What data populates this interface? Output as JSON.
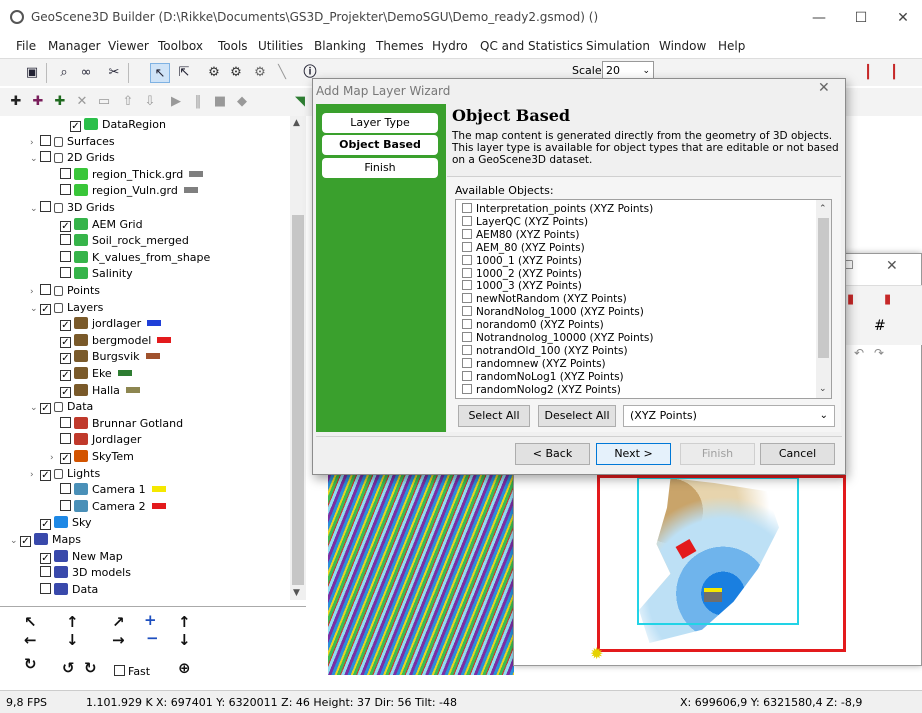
{
  "window": {
    "title": "GeoScene3D Builder (D:\\Rikke\\Documents\\GS3D_Projekter\\DemoSGU\\Demo_ready2.gsmod) ()",
    "controls": [
      "—",
      "☐",
      "✕"
    ]
  },
  "menu": [
    "File",
    "Manager",
    "Viewer",
    "Toolbox",
    "Tools",
    "Utilities",
    "Blanking",
    "Themes",
    "Hydro",
    "QC and Statistics",
    "Simulation",
    "Window",
    "Help"
  ],
  "toolbar": {
    "scale_label": "Scale:",
    "scale_value": "20"
  },
  "tree": [
    {
      "label": "DataRegion",
      "checked": true,
      "icon": "region-icon",
      "icon_color": "#2bbf4a"
    },
    {
      "label": "Surfaces",
      "checked": false,
      "icon": "folder-icon"
    },
    {
      "label": "2D Grids",
      "checked": false,
      "icon": "folder-icon"
    },
    {
      "label": "region_Thick.grd",
      "checked": false,
      "icon": "grid2d-icon",
      "icon_color": "#39c639",
      "swatch": "#7f7f7f"
    },
    {
      "label": "region_Vuln.grd",
      "checked": false,
      "icon": "grid2d-icon",
      "icon_color": "#39c639",
      "swatch": "#7f7f7f"
    },
    {
      "label": "3D Grids",
      "checked": false,
      "icon": "folder-icon"
    },
    {
      "label": "AEM Grid",
      "checked": true,
      "icon": "grid3d-icon",
      "icon_color": "#36b44a"
    },
    {
      "label": "Soil_rock_merged",
      "checked": false,
      "icon": "grid3d-icon",
      "icon_color": "#36b44a"
    },
    {
      "label": "K_values_from_shape",
      "checked": false,
      "icon": "grid3d-icon",
      "icon_color": "#36b44a"
    },
    {
      "label": "Salinity",
      "checked": false,
      "icon": "grid3d-icon",
      "icon_color": "#36b44a"
    },
    {
      "label": "Points",
      "checked": false,
      "icon": "folder-icon"
    },
    {
      "label": "Layers",
      "checked": true,
      "icon": "folder-icon"
    },
    {
      "label": "jordlager",
      "checked": true,
      "icon": "layer-icon",
      "icon_color": "#7a5a2a",
      "swatch": "#1f3fd8"
    },
    {
      "label": "bergmodel",
      "checked": true,
      "icon": "layer-icon",
      "icon_color": "#7a5a2a",
      "swatch": "#e31a1c"
    },
    {
      "label": "Burgsvik",
      "checked": true,
      "icon": "layer-icon",
      "icon_color": "#7a5a2a",
      "swatch": "#a0522d"
    },
    {
      "label": "Eke",
      "checked": true,
      "icon": "layer-icon",
      "icon_color": "#7a5a2a",
      "swatch": "#2e7d32"
    },
    {
      "label": "Halla",
      "checked": true,
      "icon": "layer-icon",
      "icon_color": "#7a5a2a",
      "swatch": "#8d8650"
    },
    {
      "label": "Data",
      "checked": true,
      "icon": "folder-icon"
    },
    {
      "label": "Brunnar Gotland",
      "checked": false,
      "icon": "wells-icon",
      "icon_color": "#c0392b"
    },
    {
      "label": "Jordlager",
      "checked": false,
      "icon": "wells-icon",
      "icon_color": "#c0392b"
    },
    {
      "label": "SkyTem",
      "checked": true,
      "icon": "skytem-icon",
      "icon_color": "#d35400"
    },
    {
      "label": "Lights",
      "checked": true,
      "icon": "folder-icon"
    },
    {
      "label": "Camera 1",
      "checked": false,
      "icon": "camera-icon",
      "icon_color": "#4a90b8",
      "swatch": "#f5e800"
    },
    {
      "label": "Camera 2",
      "checked": false,
      "icon": "camera-icon",
      "icon_color": "#4a90b8",
      "swatch": "#e31a1c"
    },
    {
      "label": "Sky",
      "checked": true,
      "icon": "sky-icon",
      "icon_color": "#1e88e5"
    },
    {
      "label": "Maps",
      "checked": true,
      "icon": "maps-icon",
      "icon_color": "#3949ab"
    },
    {
      "label": "New Map",
      "checked": true,
      "icon": "map-icon",
      "icon_color": "#3949ab"
    },
    {
      "label": "3D models",
      "checked": false,
      "icon": "map-icon",
      "icon_color": "#3949ab"
    },
    {
      "label": "Data",
      "checked": false,
      "icon": "map-icon",
      "icon_color": "#3949ab"
    }
  ],
  "navpad": {
    "fast_label": "Fast"
  },
  "dialog": {
    "title": "Add Map Layer Wizard",
    "steps": [
      "Layer Type",
      "Object Based",
      "Finish"
    ],
    "active_step": "Object Based",
    "heading": "Object Based",
    "description": "The map content is generated directly from the geometry of 3D objects. This layer type is available for object types that are editable or not based on a GeoScene3D dataset.",
    "available_label": "Available Objects:",
    "objects": [
      "Interpretation_points (XYZ Points)",
      "LayerQC (XYZ Points)",
      "AEM80 (XYZ Points)",
      "AEM_80 (XYZ Points)",
      "1000_1 (XYZ Points)",
      "1000_2 (XYZ Points)",
      "1000_3 (XYZ Points)",
      "newNotRandom (XYZ Points)",
      "NorandNolog_1000 (XYZ Points)",
      "norandom0 (XYZ Points)",
      "Notrandnolog_10000 (XYZ Points)",
      "notrandOld_100 (XYZ Points)",
      "randomnew (XYZ Points)",
      "randomNoLog1 (XYZ Points)",
      "randomNolog2 (XYZ Points)"
    ],
    "select_all": "Select All",
    "deselect_all": "Deselect All",
    "type_filter": "(XYZ Points)",
    "back": "< Back",
    "next": "Next >",
    "finish": "Finish",
    "cancel": "Cancel"
  },
  "status": {
    "fps": "9,8 FPS",
    "triangles": "1.101.929 K",
    "camera": "X: 697401  Y: 6320011  Z: 46  Height: 37  Dir: 56  Tilt: -48",
    "cursor": "X: 699606,9  Y: 6321580,4  Z: -8,9"
  },
  "colors": {
    "wizard_side": "#3aa02d",
    "map_frame": "#e31a1c",
    "map_cyan": "#22d3e6",
    "accent": "#0078d7"
  }
}
